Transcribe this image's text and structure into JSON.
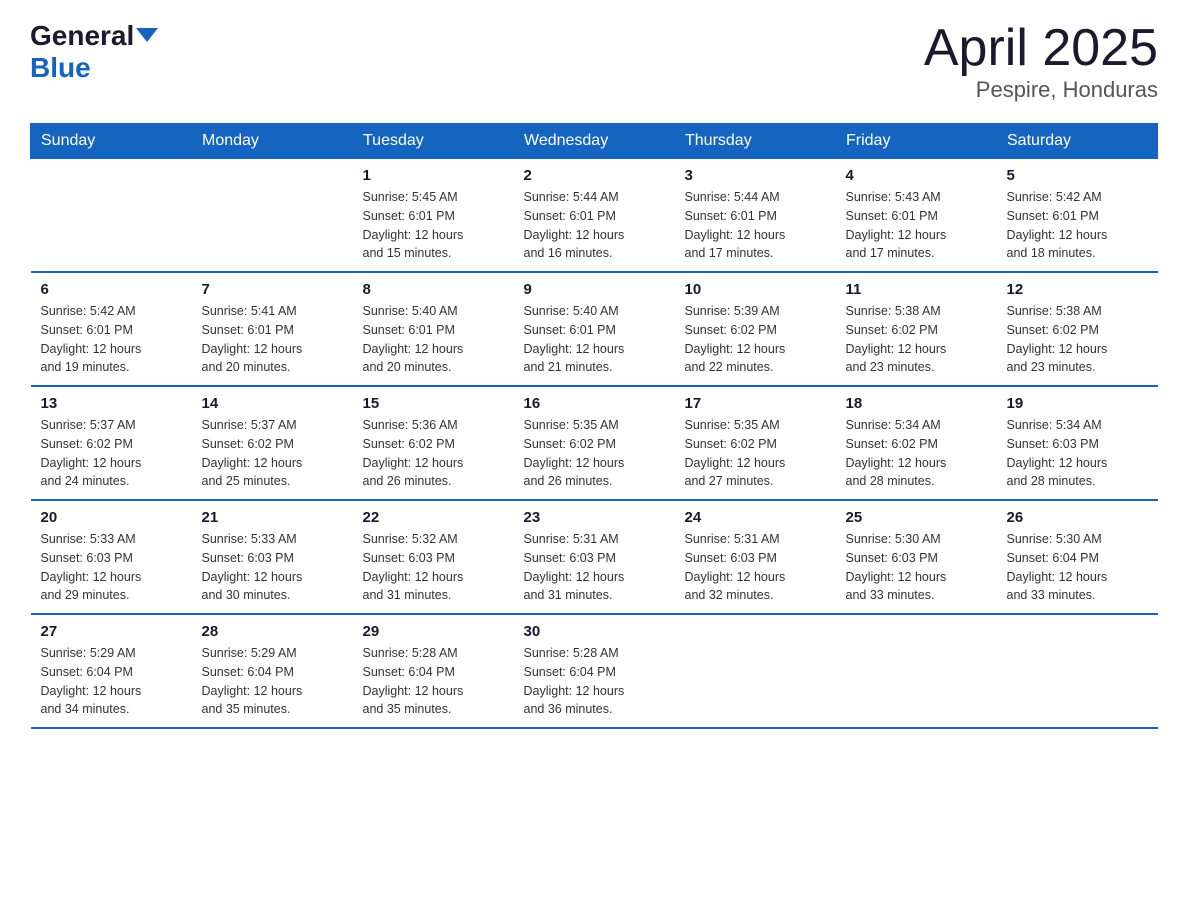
{
  "logo": {
    "text_general": "General",
    "text_blue": "Blue",
    "arrow": "▲"
  },
  "title": "April 2025",
  "subtitle": "Pespire, Honduras",
  "days_header": [
    "Sunday",
    "Monday",
    "Tuesday",
    "Wednesday",
    "Thursday",
    "Friday",
    "Saturday"
  ],
  "weeks": [
    [
      {
        "day": "",
        "info": ""
      },
      {
        "day": "",
        "info": ""
      },
      {
        "day": "1",
        "info": "Sunrise: 5:45 AM\nSunset: 6:01 PM\nDaylight: 12 hours\nand 15 minutes."
      },
      {
        "day": "2",
        "info": "Sunrise: 5:44 AM\nSunset: 6:01 PM\nDaylight: 12 hours\nand 16 minutes."
      },
      {
        "day": "3",
        "info": "Sunrise: 5:44 AM\nSunset: 6:01 PM\nDaylight: 12 hours\nand 17 minutes."
      },
      {
        "day": "4",
        "info": "Sunrise: 5:43 AM\nSunset: 6:01 PM\nDaylight: 12 hours\nand 17 minutes."
      },
      {
        "day": "5",
        "info": "Sunrise: 5:42 AM\nSunset: 6:01 PM\nDaylight: 12 hours\nand 18 minutes."
      }
    ],
    [
      {
        "day": "6",
        "info": "Sunrise: 5:42 AM\nSunset: 6:01 PM\nDaylight: 12 hours\nand 19 minutes."
      },
      {
        "day": "7",
        "info": "Sunrise: 5:41 AM\nSunset: 6:01 PM\nDaylight: 12 hours\nand 20 minutes."
      },
      {
        "day": "8",
        "info": "Sunrise: 5:40 AM\nSunset: 6:01 PM\nDaylight: 12 hours\nand 20 minutes."
      },
      {
        "day": "9",
        "info": "Sunrise: 5:40 AM\nSunset: 6:01 PM\nDaylight: 12 hours\nand 21 minutes."
      },
      {
        "day": "10",
        "info": "Sunrise: 5:39 AM\nSunset: 6:02 PM\nDaylight: 12 hours\nand 22 minutes."
      },
      {
        "day": "11",
        "info": "Sunrise: 5:38 AM\nSunset: 6:02 PM\nDaylight: 12 hours\nand 23 minutes."
      },
      {
        "day": "12",
        "info": "Sunrise: 5:38 AM\nSunset: 6:02 PM\nDaylight: 12 hours\nand 23 minutes."
      }
    ],
    [
      {
        "day": "13",
        "info": "Sunrise: 5:37 AM\nSunset: 6:02 PM\nDaylight: 12 hours\nand 24 minutes."
      },
      {
        "day": "14",
        "info": "Sunrise: 5:37 AM\nSunset: 6:02 PM\nDaylight: 12 hours\nand 25 minutes."
      },
      {
        "day": "15",
        "info": "Sunrise: 5:36 AM\nSunset: 6:02 PM\nDaylight: 12 hours\nand 26 minutes."
      },
      {
        "day": "16",
        "info": "Sunrise: 5:35 AM\nSunset: 6:02 PM\nDaylight: 12 hours\nand 26 minutes."
      },
      {
        "day": "17",
        "info": "Sunrise: 5:35 AM\nSunset: 6:02 PM\nDaylight: 12 hours\nand 27 minutes."
      },
      {
        "day": "18",
        "info": "Sunrise: 5:34 AM\nSunset: 6:02 PM\nDaylight: 12 hours\nand 28 minutes."
      },
      {
        "day": "19",
        "info": "Sunrise: 5:34 AM\nSunset: 6:03 PM\nDaylight: 12 hours\nand 28 minutes."
      }
    ],
    [
      {
        "day": "20",
        "info": "Sunrise: 5:33 AM\nSunset: 6:03 PM\nDaylight: 12 hours\nand 29 minutes."
      },
      {
        "day": "21",
        "info": "Sunrise: 5:33 AM\nSunset: 6:03 PM\nDaylight: 12 hours\nand 30 minutes."
      },
      {
        "day": "22",
        "info": "Sunrise: 5:32 AM\nSunset: 6:03 PM\nDaylight: 12 hours\nand 31 minutes."
      },
      {
        "day": "23",
        "info": "Sunrise: 5:31 AM\nSunset: 6:03 PM\nDaylight: 12 hours\nand 31 minutes."
      },
      {
        "day": "24",
        "info": "Sunrise: 5:31 AM\nSunset: 6:03 PM\nDaylight: 12 hours\nand 32 minutes."
      },
      {
        "day": "25",
        "info": "Sunrise: 5:30 AM\nSunset: 6:03 PM\nDaylight: 12 hours\nand 33 minutes."
      },
      {
        "day": "26",
        "info": "Sunrise: 5:30 AM\nSunset: 6:04 PM\nDaylight: 12 hours\nand 33 minutes."
      }
    ],
    [
      {
        "day": "27",
        "info": "Sunrise: 5:29 AM\nSunset: 6:04 PM\nDaylight: 12 hours\nand 34 minutes."
      },
      {
        "day": "28",
        "info": "Sunrise: 5:29 AM\nSunset: 6:04 PM\nDaylight: 12 hours\nand 35 minutes."
      },
      {
        "day": "29",
        "info": "Sunrise: 5:28 AM\nSunset: 6:04 PM\nDaylight: 12 hours\nand 35 minutes."
      },
      {
        "day": "30",
        "info": "Sunrise: 5:28 AM\nSunset: 6:04 PM\nDaylight: 12 hours\nand 36 minutes."
      },
      {
        "day": "",
        "info": ""
      },
      {
        "day": "",
        "info": ""
      },
      {
        "day": "",
        "info": ""
      }
    ]
  ]
}
